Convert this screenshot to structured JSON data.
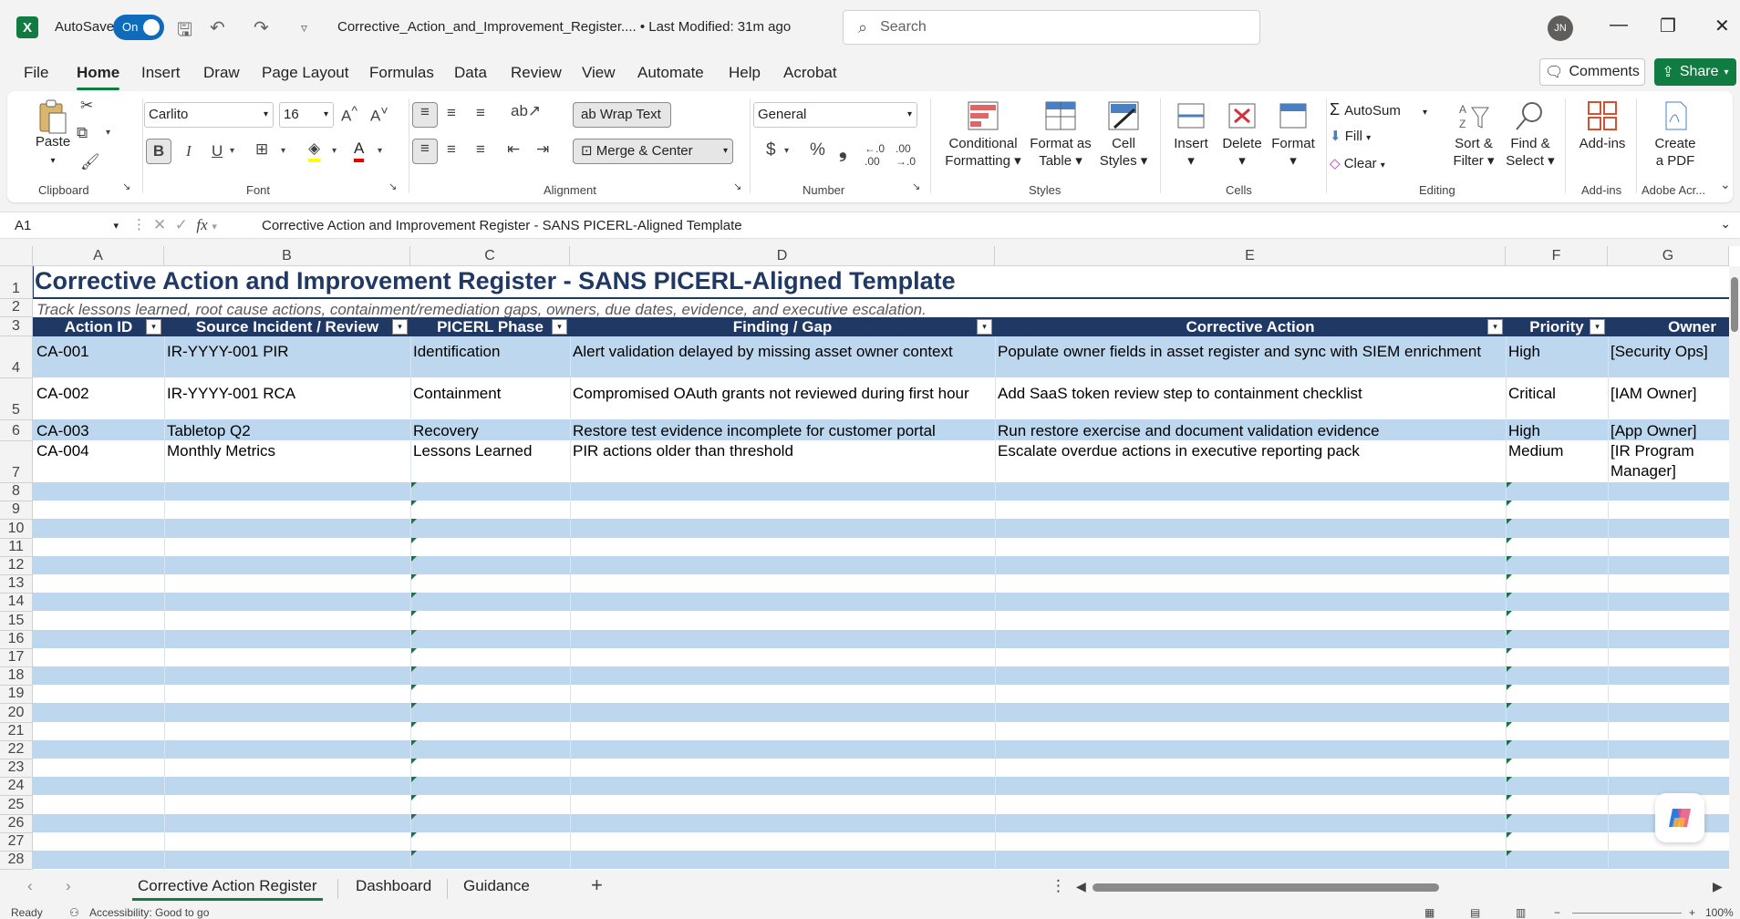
{
  "titlebar": {
    "autosave_label": "AutoSave",
    "autosave_state": "On",
    "doc_title": "Corrective_Action_and_Improvement_Register.... • Last Modified: 31m ago",
    "search_placeholder": "Search",
    "avatar_initials": "JN"
  },
  "menu": [
    "File",
    "Home",
    "Insert",
    "Draw",
    "Page Layout",
    "Formulas",
    "Data",
    "Review",
    "View",
    "Automate",
    "Help",
    "Acrobat"
  ],
  "menu_active": "Home",
  "comments_label": "Comments",
  "share_label": "Share",
  "ribbon": {
    "clipboard": {
      "paste": "Paste",
      "label": "Clipboard"
    },
    "font": {
      "name": "Carlito",
      "size": "16",
      "label": "Font",
      "bold": "B",
      "italic": "I",
      "underline": "U"
    },
    "alignment": {
      "wrap": "Wrap Text",
      "merge": "Merge & Center",
      "label": "Alignment"
    },
    "number": {
      "format": "General",
      "label": "Number",
      "currency": "$",
      "percent": "%",
      "comma": "❟"
    },
    "styles": {
      "conditional": "Conditional",
      "conditional2": "Formatting",
      "format_table": "Format as",
      "format_table2": "Table",
      "cell_styles": "Cell",
      "cell_styles2": "Styles",
      "label": "Styles"
    },
    "cells": {
      "insert": "Insert",
      "delete": "Delete",
      "format": "Format",
      "label": "Cells"
    },
    "editing": {
      "autosum": "AutoSum",
      "fill": "Fill",
      "clear": "Clear",
      "sort": "Sort &",
      "sort2": "Filter",
      "find": "Find &",
      "find2": "Select",
      "label": "Editing"
    },
    "addins": {
      "addins": "Add-ins",
      "label": "Add-ins"
    },
    "adobe": {
      "create": "Create",
      "create2": "a PDF",
      "label": "Adobe Acr..."
    }
  },
  "formula_bar": {
    "name_box": "A1",
    "formula": "Corrective Action and Improvement Register - SANS PICERL-Aligned Template"
  },
  "columns": [
    "A",
    "B",
    "C",
    "D",
    "E",
    "F",
    "G"
  ],
  "rows": [
    "1",
    "2",
    "3",
    "4",
    "5",
    "6",
    "7",
    "8",
    "9",
    "10",
    "11",
    "12",
    "13",
    "14",
    "15",
    "16",
    "17",
    "18",
    "19",
    "20",
    "21",
    "22",
    "23",
    "24",
    "25",
    "26",
    "27",
    "28"
  ],
  "sheet": {
    "title": "Corrective Action and Improvement Register - SANS PICERL-Aligned Template",
    "subtitle": "Track lessons learned, root cause actions, containment/remediation gaps, owners, due dates, evidence, and executive escalation.",
    "headers": [
      "Action ID",
      "Source Incident / Review",
      "PICERL Phase",
      "Finding / Gap",
      "Corrective Action",
      "Priority",
      "Owner"
    ],
    "records": [
      [
        "CA-001",
        "IR-YYYY-001 PIR",
        "Identification",
        "Alert validation delayed by missing asset owner context",
        "Populate owner fields in asset register and sync with SIEM enrichment",
        "High",
        "[Security Ops]"
      ],
      [
        "CA-002",
        "IR-YYYY-001 RCA",
        "Containment",
        "Compromised OAuth grants not reviewed during first hour",
        "Add SaaS token review step to containment checklist",
        "Critical",
        "[IAM Owner]"
      ],
      [
        "CA-003",
        "Tabletop Q2",
        "Recovery",
        "Restore test evidence incomplete for customer portal",
        "Run restore exercise and document validation evidence",
        "High",
        "[App Owner]"
      ],
      [
        "CA-004",
        "Monthly Metrics",
        "Lessons Learned",
        "PIR actions older than threshold",
        "Escalate overdue actions in executive reporting pack",
        "Medium",
        "[IR Program Manager]"
      ]
    ]
  },
  "tabs": [
    "Corrective Action Register",
    "Dashboard",
    "Guidance"
  ],
  "status": {
    "ready": "Ready",
    "accessibility": "Accessibility: Good to go",
    "zoom": "100%"
  },
  "colors": {
    "excel_green": "#107c41",
    "header_navy": "#1f3864",
    "band_blue": "#bdd7ee"
  }
}
